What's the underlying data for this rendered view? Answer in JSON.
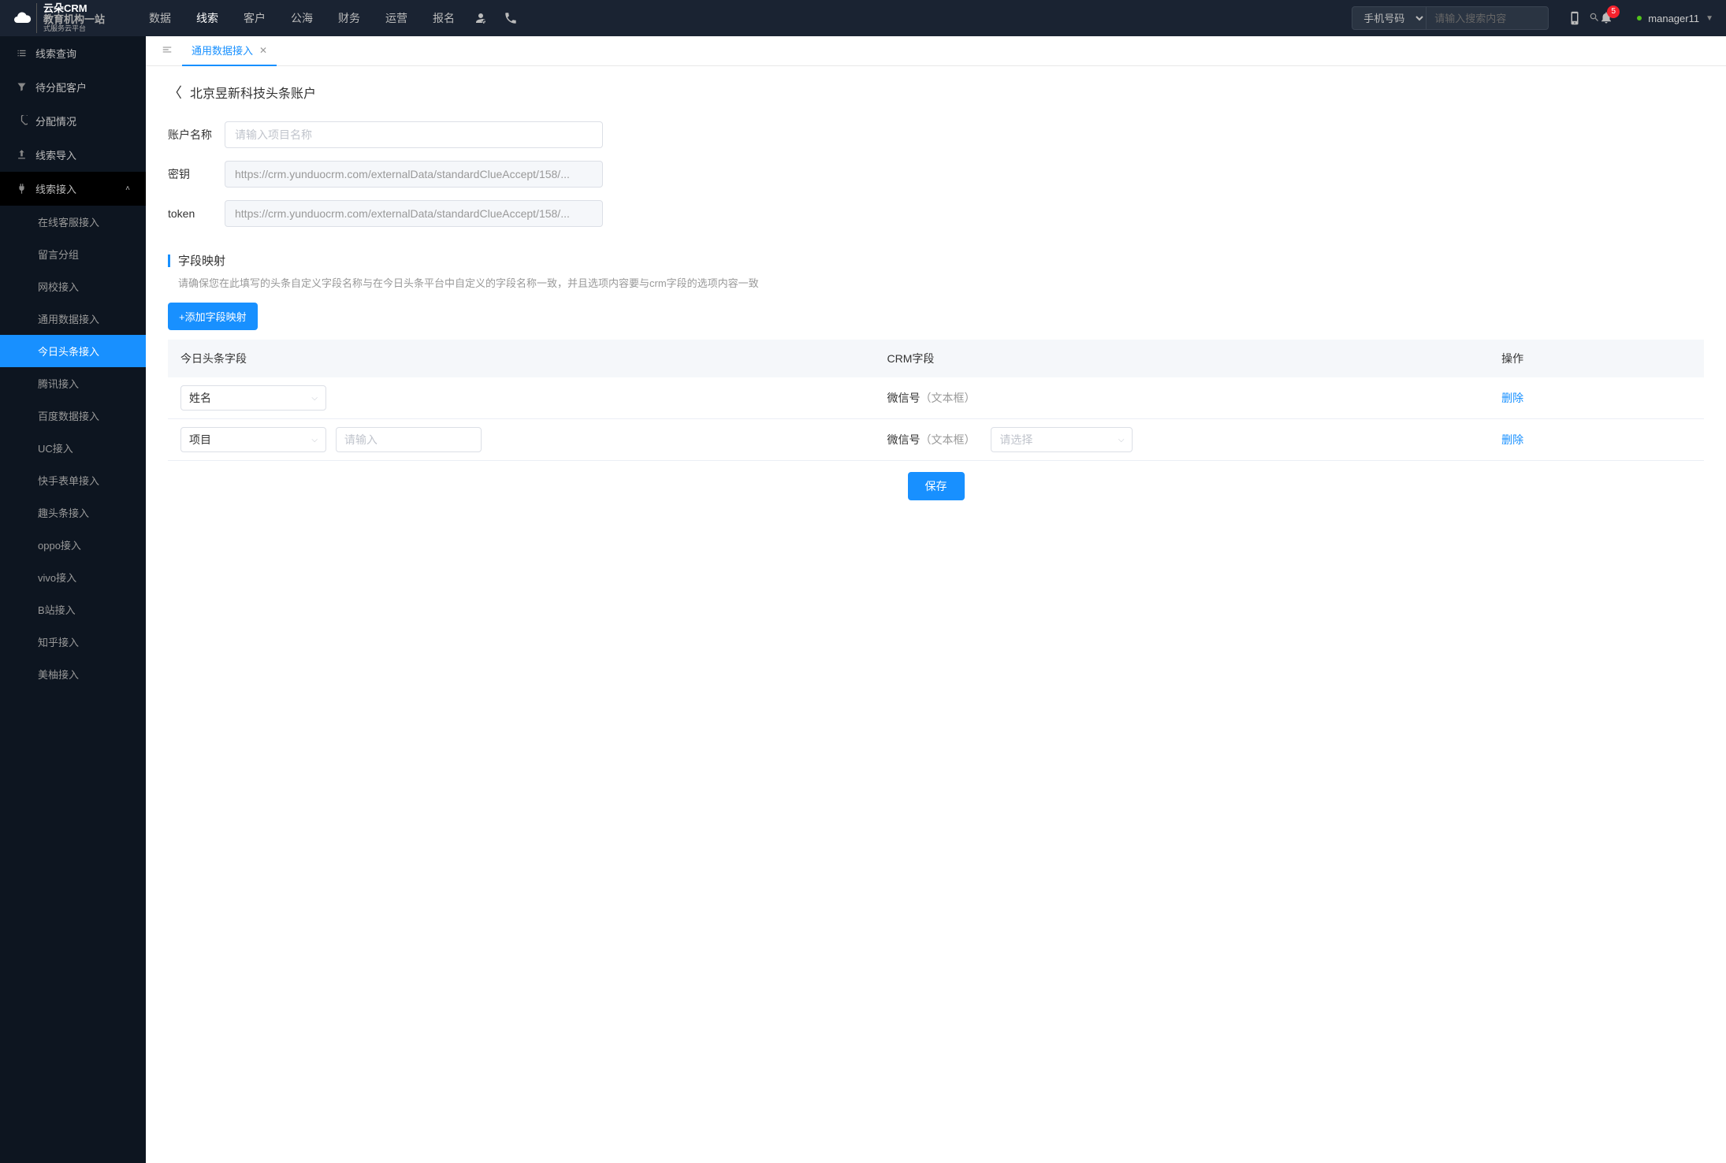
{
  "logo": {
    "brand": "云朵CRM",
    "sub1": "教育机构一站",
    "sub2": "式服务云平台"
  },
  "nav": [
    "数据",
    "线索",
    "客户",
    "公海",
    "财务",
    "运营",
    "报名"
  ],
  "nav_active": 1,
  "search": {
    "select": "手机号码",
    "placeholder": "请输入搜索内容"
  },
  "notif_count": "5",
  "user": "manager11",
  "sidebar": {
    "items": [
      {
        "label": "线索查询",
        "icon": "list"
      },
      {
        "label": "待分配客户",
        "icon": "filter"
      },
      {
        "label": "分配情况",
        "icon": "pie"
      },
      {
        "label": "线索导入",
        "icon": "upload"
      },
      {
        "label": "线索接入",
        "icon": "plug",
        "expanded": true,
        "children": [
          "在线客服接入",
          "留言分组",
          "网校接入",
          "通用数据接入",
          "今日头条接入",
          "腾讯接入",
          "百度数据接入",
          "UC接入",
          "快手表单接入",
          "趣头条接入",
          "oppo接入",
          "vivo接入",
          "B站接入",
          "知乎接入",
          "美柚接入"
        ],
        "active_child": 4
      }
    ]
  },
  "tab": {
    "label": "通用数据接入"
  },
  "page": {
    "title": "北京昱新科技头条账户",
    "fields": {
      "name": {
        "label": "账户名称",
        "placeholder": "请输入项目名称",
        "value": ""
      },
      "secret": {
        "label": "密钥",
        "value": "https://crm.yunduocrm.com/externalData/standardClueAccept/158/..."
      },
      "token": {
        "label": "token",
        "value": "https://crm.yunduocrm.com/externalData/standardClueAccept/158/..."
      }
    },
    "mapping": {
      "title": "字段映射",
      "desc": "请确保您在此填写的头条自定义字段名称与在今日头条平台中自定义的字段名称一致，并且选项内容要与crm字段的选项内容一致",
      "add_btn": "+添加字段映射",
      "headers": [
        "今日头条字段",
        "CRM字段",
        "操作"
      ],
      "rows": [
        {
          "field": "姓名",
          "crm_label": "微信号",
          "crm_hint": "（文本框）",
          "del": "删除",
          "has_extra": false
        },
        {
          "field": "项目",
          "input_ph": "请输入",
          "crm_label": "微信号",
          "crm_hint": "（文本框）",
          "select_ph": "请选择",
          "del": "删除",
          "has_extra": true
        }
      ]
    },
    "save": "保存"
  }
}
